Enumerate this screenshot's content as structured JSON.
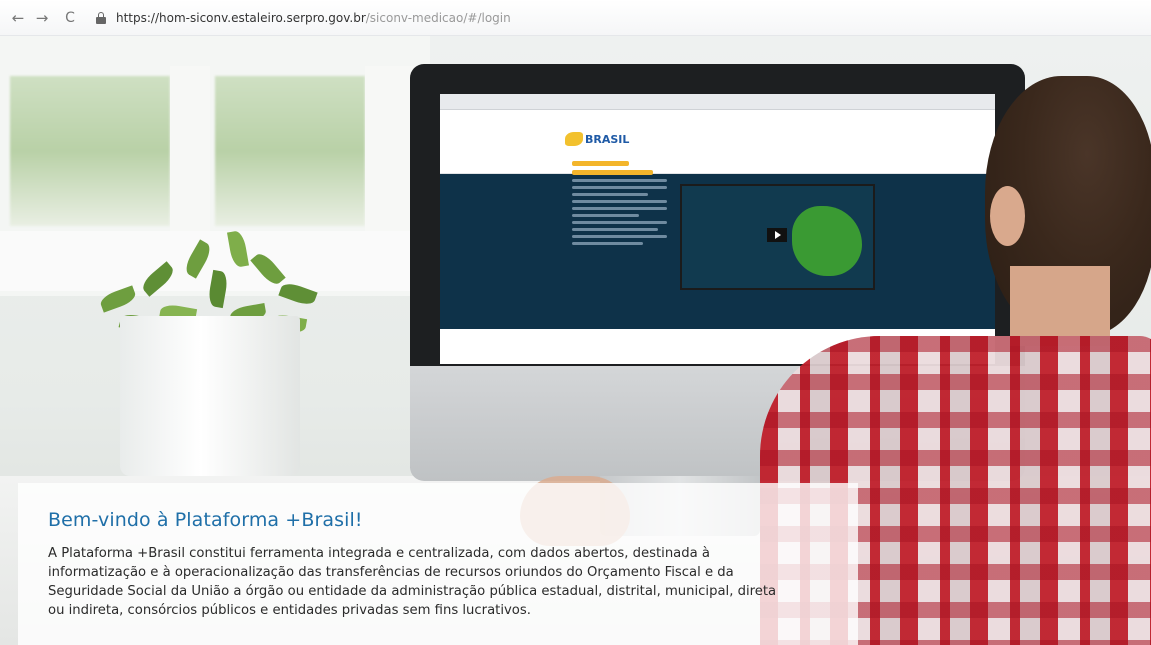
{
  "browser": {
    "url_host": "https://hom-siconv.estaleiro.serpro.gov.br",
    "url_path": "/siconv-medicao/#/login",
    "back_glyph": "←",
    "forward_glyph": "→",
    "reload_glyph": "C"
  },
  "welcome": {
    "title": "Bem-vindo à Plataforma +Brasil!",
    "description": "A Plataforma +Brasil constitui ferramenta integrada e centralizada, com dados abertos, destinada à informatização e à operacionalização das transferências de recursos oriundos do Orçamento Fiscal e da Seguridade Social da União a órgão ou entidade da administração pública estadual, distrital, municipal, direta ou indireta, consórcios públicos e entidades privadas sem fins lucrativos."
  },
  "colors": {
    "frame": "#1f3f73",
    "title": "#1f6fa8",
    "body_text": "#2b2b2b"
  }
}
